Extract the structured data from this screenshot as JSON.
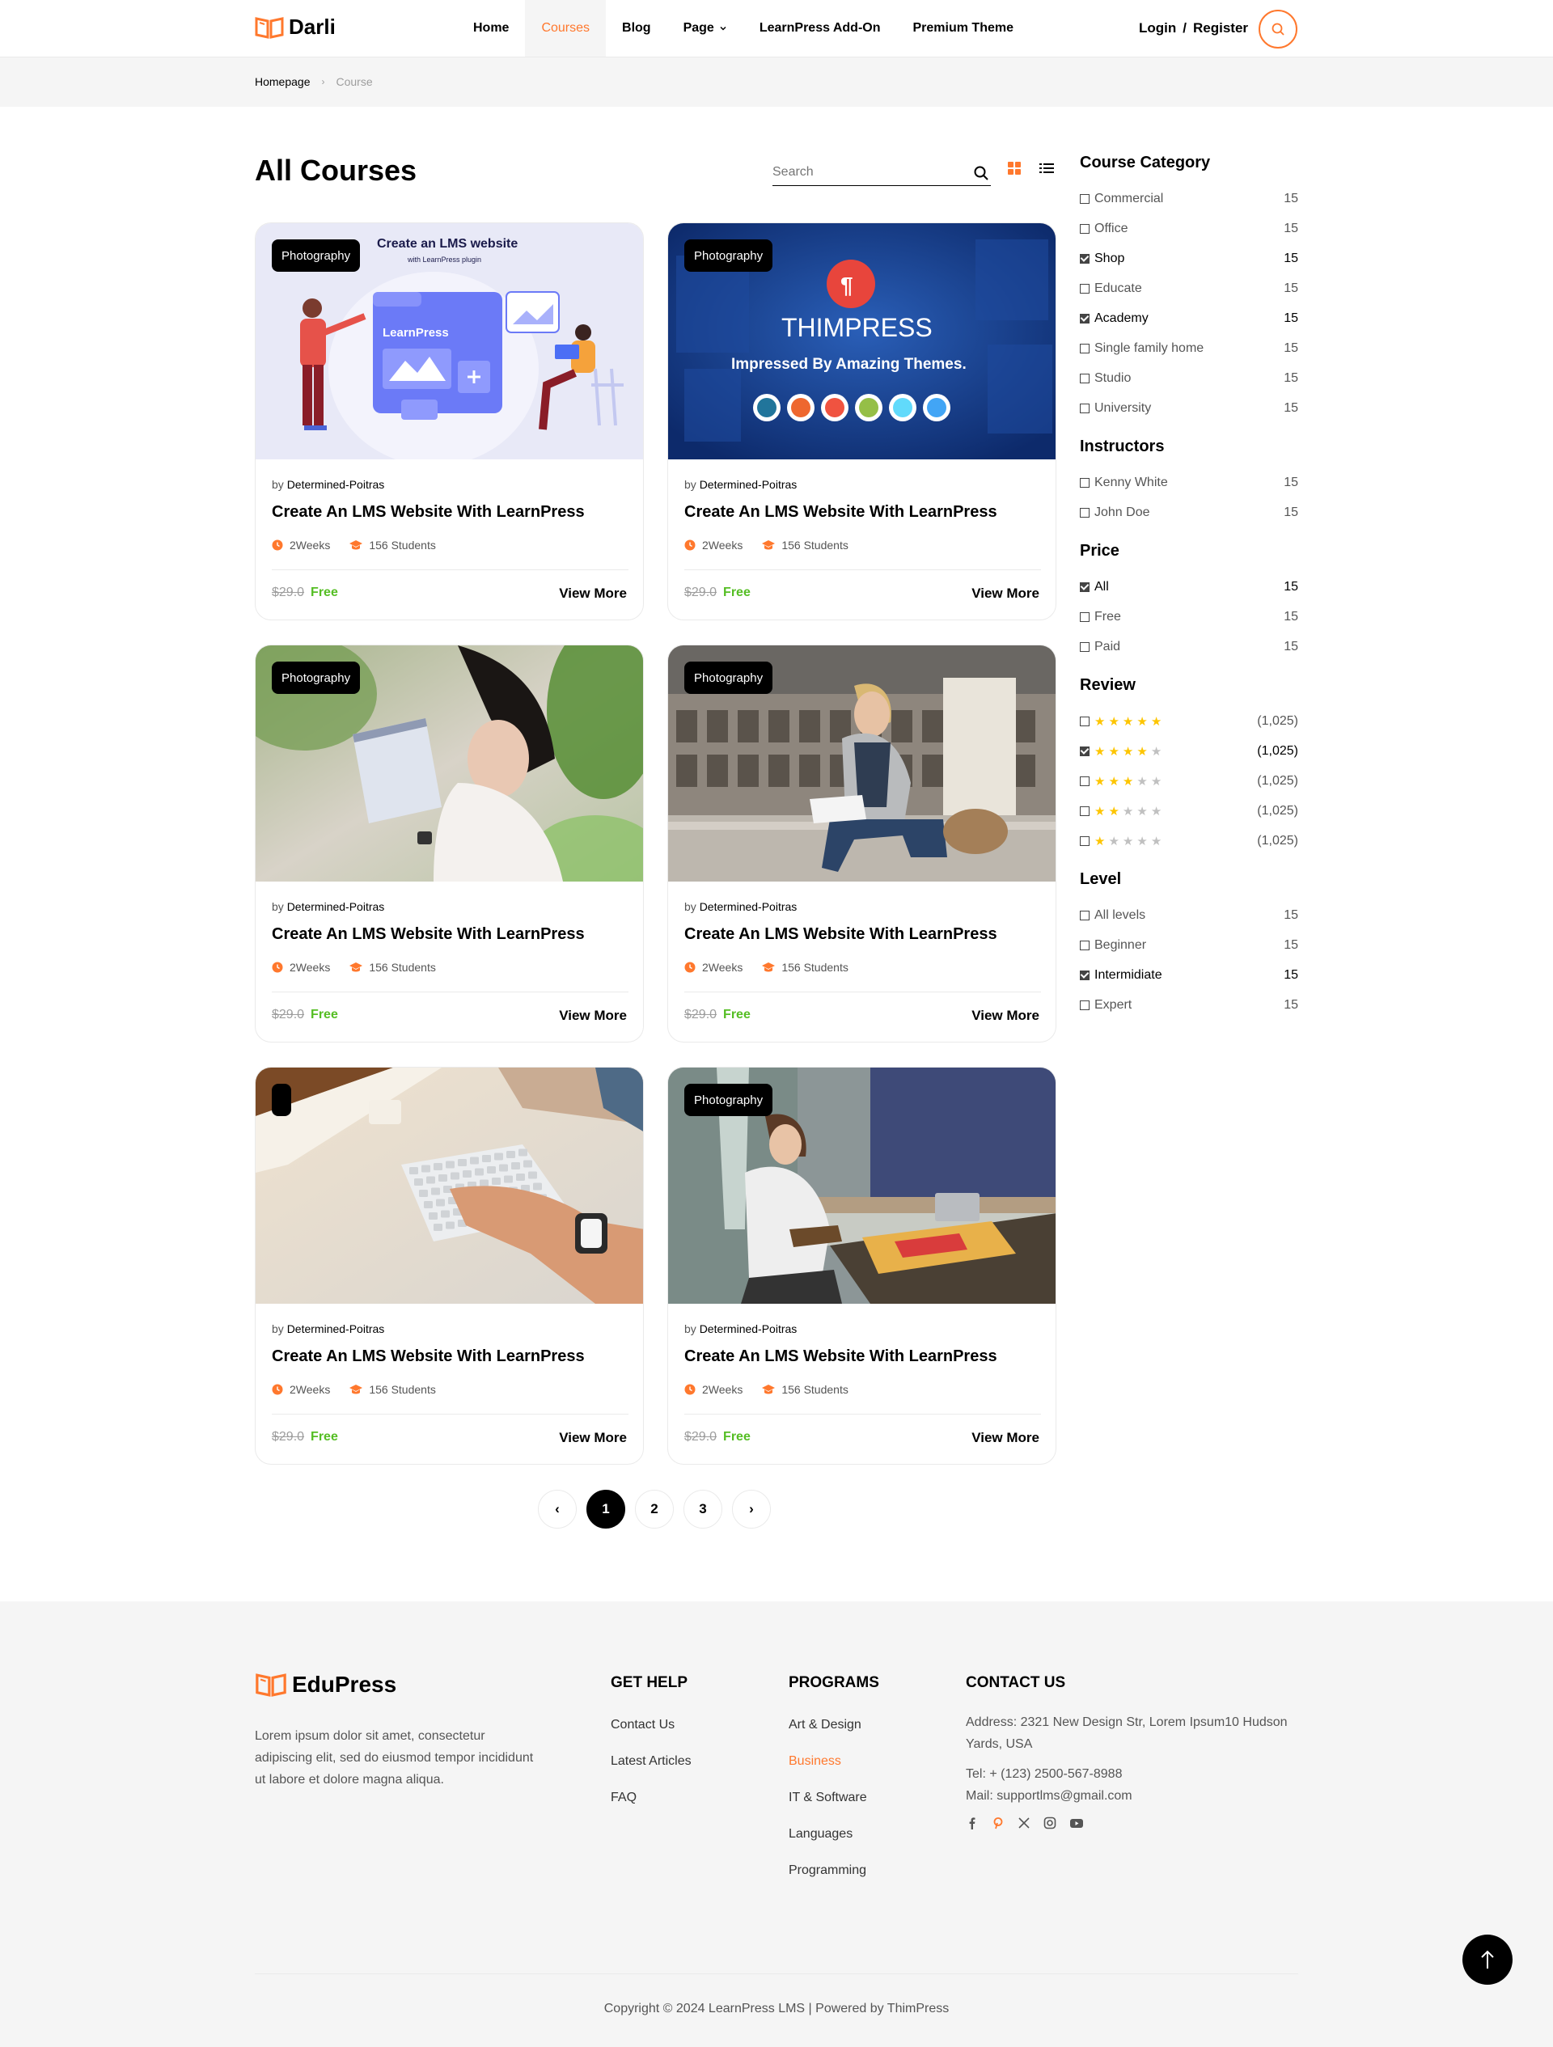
{
  "colors": {
    "accent": "#ff782d",
    "free": "#55be24",
    "star": "#fdc500",
    "text": "#000000",
    "muted": "#9d9d9d",
    "bg_gray": "#f5f5f5"
  },
  "header": {
    "logo": "Darli",
    "nav": [
      {
        "label": "Home"
      },
      {
        "label": "Courses",
        "active": true
      },
      {
        "label": "Blog"
      },
      {
        "label": "Page"
      },
      {
        "label": "LearnPress Add-On"
      },
      {
        "label": "Premium Theme"
      }
    ],
    "login": "Login",
    "slash": "/",
    "register": "Register"
  },
  "breadcrumb": {
    "home": "Homepage",
    "current": "Course"
  },
  "main": {
    "title": "All Courses",
    "search_placeholder": "Search"
  },
  "cards": [
    {
      "badge": "Photography",
      "by": "by",
      "author": "Determined-Poitras",
      "title": "Create An LMS Website With LearnPress",
      "duration": "2Weeks",
      "students": "156 Students",
      "old_price": "$29.0",
      "price": "Free",
      "more": "View More",
      "image": "lms-illustration",
      "img_title": "Create an LMS website",
      "img_sub": "with LearnPress plugin",
      "img_label": "LearnPress"
    },
    {
      "badge": "Photography",
      "by": "by",
      "author": "Determined-Poitras",
      "title": "Create An LMS Website With LearnPress",
      "duration": "2Weeks",
      "students": "156 Students",
      "old_price": "$29.0",
      "price": "Free",
      "more": "View More",
      "image": "thimpress-banner",
      "img_title": "THIMPRESS",
      "img_sub": "Impressed By Amazing Themes."
    },
    {
      "badge": "Photography",
      "by": "by",
      "author": "Determined-Poitras",
      "title": "Create An LMS Website With LearnPress",
      "duration": "2Weeks",
      "students": "156 Students",
      "old_price": "$29.0",
      "price": "Free",
      "more": "View More",
      "image": "woman-reading-photo"
    },
    {
      "badge": "Photography",
      "by": "by",
      "author": "Determined-Poitras",
      "title": "Create An LMS Website With LearnPress",
      "duration": "2Weeks",
      "students": "156 Students",
      "old_price": "$29.0",
      "price": "Free",
      "more": "View More",
      "image": "man-reading-photo"
    },
    {
      "badge": "",
      "by": "by",
      "author": "Determined-Poitras",
      "title": "Create An LMS Website With LearnPress",
      "duration": "2Weeks",
      "students": "156 Students",
      "old_price": "$29.0",
      "price": "Free",
      "more": "View More",
      "image": "keyboard-photo"
    },
    {
      "badge": "Photography",
      "by": "by",
      "author": "Determined-Poitras",
      "title": "Create An LMS Website With LearnPress",
      "duration": "2Weeks",
      "students": "156 Students",
      "old_price": "$29.0",
      "price": "Free",
      "more": "View More",
      "image": "student-library-photo"
    }
  ],
  "pagination": {
    "pages": [
      "1",
      "2",
      "3"
    ],
    "current": "1",
    "prev": "‹",
    "next": "›"
  },
  "sidebar": {
    "category": {
      "title": "Course Category",
      "items": [
        {
          "label": "Commercial",
          "count": "15",
          "checked": false
        },
        {
          "label": "Office",
          "count": "15",
          "checked": false
        },
        {
          "label": "Shop",
          "count": "15",
          "checked": true
        },
        {
          "label": "Educate",
          "count": "15",
          "checked": false
        },
        {
          "label": "Academy",
          "count": "15",
          "checked": true
        },
        {
          "label": "Single family home",
          "count": "15",
          "checked": false
        },
        {
          "label": "Studio",
          "count": "15",
          "checked": false
        },
        {
          "label": "University",
          "count": "15",
          "checked": false
        }
      ]
    },
    "instructors": {
      "title": "Instructors",
      "items": [
        {
          "label": "Kenny White",
          "count": "15",
          "checked": false
        },
        {
          "label": "John Doe",
          "count": "15",
          "checked": false
        }
      ]
    },
    "price": {
      "title": "Price",
      "items": [
        {
          "label": "All",
          "count": "15",
          "checked": true
        },
        {
          "label": "Free",
          "count": "15",
          "checked": false
        },
        {
          "label": "Paid",
          "count": "15",
          "checked": false
        }
      ]
    },
    "review": {
      "title": "Review",
      "items": [
        {
          "stars": 5,
          "count": "(1,025)",
          "checked": false
        },
        {
          "stars": 4,
          "count": "(1,025)",
          "checked": true
        },
        {
          "stars": 3,
          "count": "(1,025)",
          "checked": false
        },
        {
          "stars": 2,
          "count": "(1,025)",
          "checked": false
        },
        {
          "stars": 1,
          "count": "(1,025)",
          "checked": false
        }
      ]
    },
    "level": {
      "title": "Level",
      "items": [
        {
          "label": "All levels",
          "count": "15",
          "checked": false
        },
        {
          "label": "Beginner",
          "count": "15",
          "checked": false
        },
        {
          "label": "Intermidiate",
          "count": "15",
          "checked": true
        },
        {
          "label": "Expert",
          "count": "15",
          "checked": false
        }
      ]
    }
  },
  "footer": {
    "logo": "EduPress",
    "about": "Lorem ipsum dolor sit amet, consectetur adipiscing elit, sed do eiusmod tempor incididunt ut labore et dolore magna aliqua.",
    "get_help": {
      "title": "GET HELP",
      "links": [
        "Contact Us",
        "Latest Articles",
        "FAQ"
      ]
    },
    "programs": {
      "title": "PROGRAMS",
      "links": [
        "Art & Design",
        "Business",
        "IT & Software",
        "Languages",
        "Programming"
      ],
      "accent_index": 1
    },
    "contact": {
      "title": "CONTACT US",
      "address": "Address: 2321 New Design Str, Lorem Ipsum10 Hudson Yards, USA",
      "tel": "Tel: + (123) 2500-567-8988",
      "mail": "Mail: supportlms@gmail.com",
      "socials": [
        "facebook-icon",
        "pinterest-icon",
        "x-icon",
        "instagram-icon",
        "youtube-icon"
      ]
    },
    "copyright": "Copyright © 2024 LearnPress LMS | Powered by ThimPress"
  }
}
